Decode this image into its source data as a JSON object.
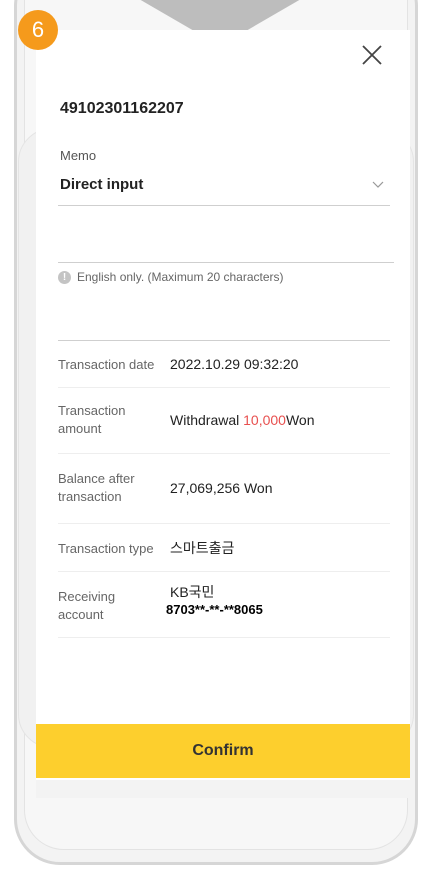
{
  "step": {
    "number": "6"
  },
  "sheet": {
    "account_number": "49102301162207",
    "memo": {
      "label": "Memo",
      "selected": "Direct input",
      "input_value": "",
      "hint": "English only. (Maximum 20 characters)"
    },
    "details": [
      {
        "label": "Transaction date",
        "value": "2022.10.29 09:32:20"
      },
      {
        "label": "Transaction amount",
        "prefix": "Withdrawal",
        "amount": "10,000",
        "suffix": "Won"
      },
      {
        "label": "Balance after transaction",
        "value": "27,069,256 Won"
      },
      {
        "label": "Transaction type",
        "value": "스마트출금"
      },
      {
        "label": "Receiving account",
        "bank": "KB국민",
        "account": "8703**-**-**8065"
      }
    ],
    "confirm_label": "Confirm"
  },
  "colors": {
    "accent_yellow": "#fdcf2d",
    "badge_orange": "#f59a1c",
    "amount_red": "#e8504f"
  },
  "icons": [
    "close-icon",
    "chevron-down-icon",
    "info-icon"
  ]
}
